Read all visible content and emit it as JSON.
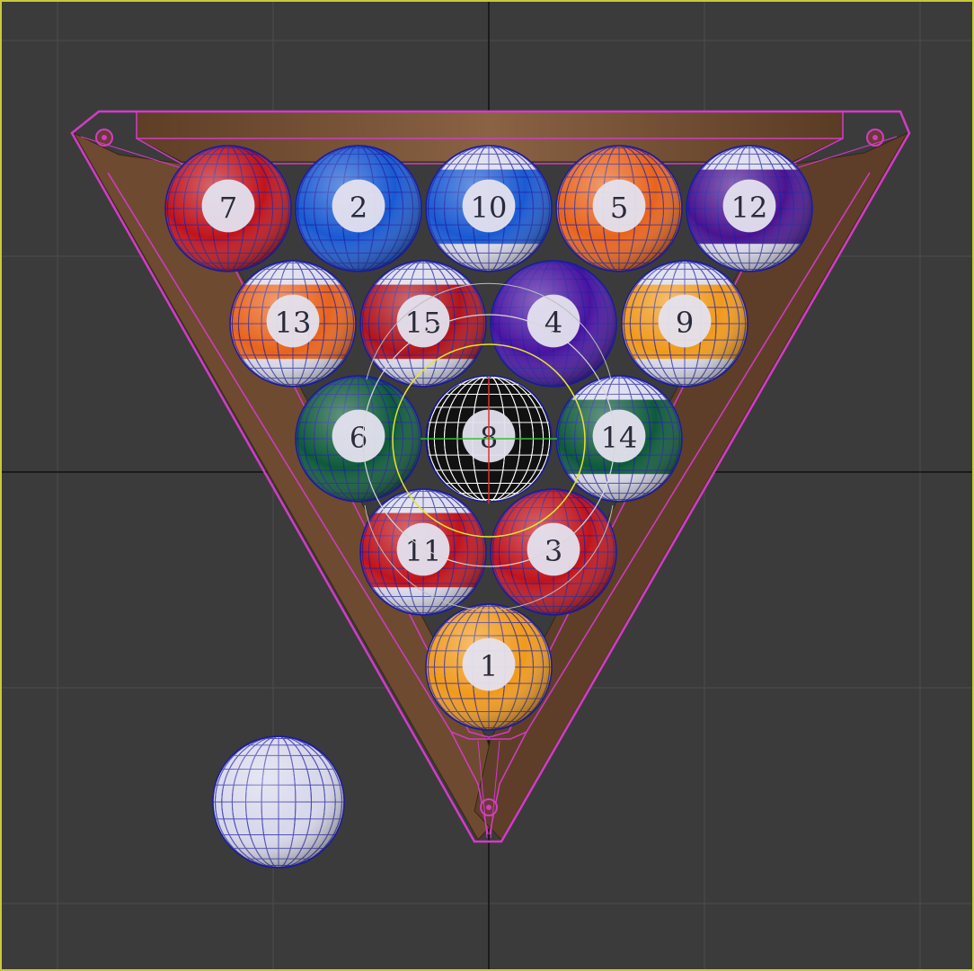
{
  "viewport": {
    "background": "#3b3b3b",
    "border_color": "#c8c83c",
    "grid_color": "#4c4c4c",
    "axis_color": "#111111",
    "selection_color": "#d23cc8",
    "wire_color": "#1a1aa0"
  },
  "rack": {
    "name": "triangle-rack",
    "wood_color": "#7a5436"
  },
  "balls": [
    {
      "number": "7",
      "color": "#c0141c",
      "type": "solid"
    },
    {
      "number": "2",
      "color": "#1a5ad2",
      "type": "solid"
    },
    {
      "number": "10",
      "color": "#1a5ad2",
      "type": "stripe"
    },
    {
      "number": "5",
      "color": "#e8641c",
      "type": "solid"
    },
    {
      "number": "12",
      "color": "#4a1490",
      "type": "stripe"
    },
    {
      "number": "13",
      "color": "#e8641c",
      "type": "stripe"
    },
    {
      "number": "15",
      "color": "#b0141c",
      "type": "stripe"
    },
    {
      "number": "4",
      "color": "#4a14a0",
      "type": "solid"
    },
    {
      "number": "9",
      "color": "#f09a1c",
      "type": "stripe"
    },
    {
      "number": "6",
      "color": "#0e5a3a",
      "type": "solid"
    },
    {
      "number": "8",
      "color": "#ffffff",
      "type": "selected"
    },
    {
      "number": "14",
      "color": "#0e5a3a",
      "type": "stripe"
    },
    {
      "number": "11",
      "color": "#c0141c",
      "type": "stripe"
    },
    {
      "number": "3",
      "color": "#c0141c",
      "type": "solid"
    },
    {
      "number": "1",
      "color": "#f09a1c",
      "type": "solid"
    }
  ],
  "cue_ball": {
    "color": "#d8d8ec",
    "type": "cue"
  }
}
